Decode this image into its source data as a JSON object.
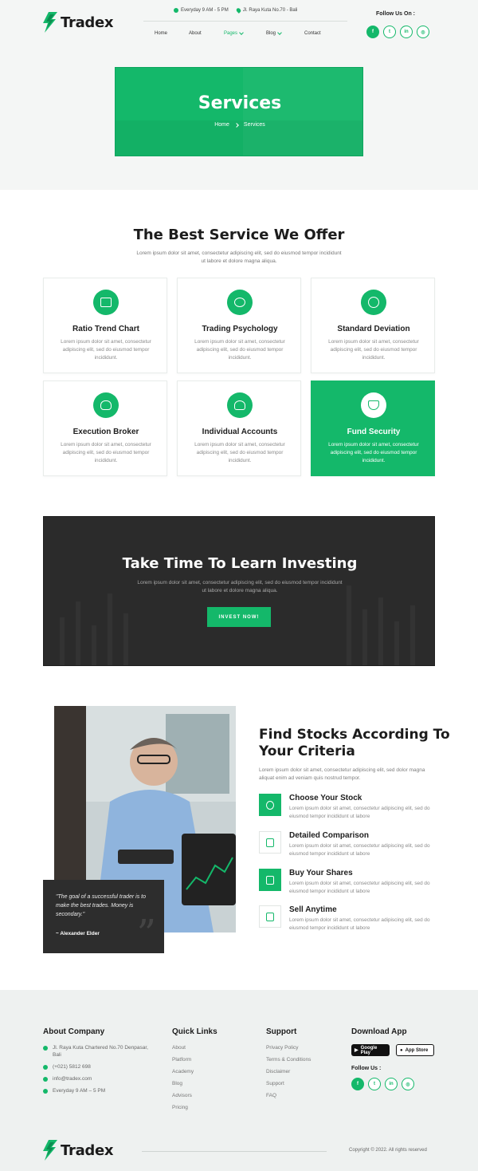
{
  "brand": {
    "name": "Tradex"
  },
  "topbar": {
    "hours": "Everyday 9 AM - 5 PM",
    "address": "Jl. Raya Kuta No.70 - Bali"
  },
  "nav": {
    "items": [
      "Home",
      "About",
      "Pages",
      "Blog",
      "Contact"
    ],
    "active": "Pages"
  },
  "follow": {
    "label": "Follow Us On :",
    "icons": [
      "facebook-icon",
      "twitter-icon",
      "linkedin-icon",
      "instagram-icon"
    ],
    "glyphs": [
      "f",
      "t",
      "in",
      "◎"
    ]
  },
  "banner": {
    "title": "Services",
    "crumb_home": "Home",
    "crumb_current": "Services"
  },
  "services": {
    "title": "The Best Service We Offer",
    "subtitle": "Lorem ipsum dolor sit amet, consectetur adipiscing elit, sed do eiusmod tempor incididunt ut labore et dolore magna aliqua.",
    "cards": [
      {
        "title": "Ratio Trend Chart",
        "text": "Lorem ipsum dolor sit amet, consectetur adipiscing elit, sed do eiusmod tempor incididunt.",
        "icon": "chart-icon"
      },
      {
        "title": "Trading Psychology",
        "text": "Lorem ipsum dolor sit amet, consectetur adipiscing elit, sed do eiusmod tempor incididunt.",
        "icon": "brain-gear-icon"
      },
      {
        "title": "Standard Deviation",
        "text": "Lorem ipsum dolor sit amet, consectetur adipiscing elit, sed do eiusmod tempor incididunt.",
        "icon": "pie-icon"
      },
      {
        "title": "Execution Broker",
        "text": "Lorem ipsum dolor sit amet, consectetur adipiscing elit, sed do eiusmod tempor incididunt.",
        "icon": "money-bag-icon"
      },
      {
        "title": "Individual Accounts",
        "text": "Lorem ipsum dolor sit amet, consectetur adipiscing elit, sed do eiusmod tempor incididunt.",
        "icon": "user-icon"
      },
      {
        "title": "Fund Security",
        "text": "Lorem ipsum dolor sit amet, consectetur adipiscing elit, sed do eiusmod tempor incididunt.",
        "icon": "shield-icon"
      }
    ]
  },
  "cta": {
    "title": "Take Time To Learn Investing",
    "subtitle": "Lorem ipsum dolor sit amet, consectetur adipiscing elit, sed do eiusmod tempor incididunt ut labore et dolore magna aliqua.",
    "button": "INVEST NOW!"
  },
  "quote": {
    "text": "\"The goal of a successful trader is to make the best trades. Money is secondary.\"",
    "author": "~ Alexander Elder"
  },
  "stocks": {
    "title": "Find Stocks According To Your Criteria",
    "subtitle": "Lorem ipsum dolor sit amet, consectetur adipiscing elit, sed dolor magna aliquat enim ad veniam quis nostrud tempor.",
    "features": [
      {
        "title": "Choose Your Stock",
        "text": "Lorem ipsum dolor sit amet, consectetur adipiscing elit, sed do eiusmod tempor incididunt ut labore"
      },
      {
        "title": "Detailed Comparison",
        "text": "Lorem ipsum dolor sit amet, consectetur adipiscing elit, sed do eiusmod tempor incididunt ut labore"
      },
      {
        "title": "Buy Your Shares",
        "text": "Lorem ipsum dolor sit amet, consectetur adipiscing elit, sed do eiusmod tempor incididunt ut labore"
      },
      {
        "title": "Sell Anytime",
        "text": "Lorem ipsum dolor sit amet, consectetur adipiscing elit, sed do eiusmod tempor incididunt ut labore"
      }
    ]
  },
  "footer": {
    "about": {
      "title": "About Company",
      "address": "Jl. Raya Kuta Chartered No.70 Denpasar, Bali",
      "phone": "(+021) 5812 698",
      "email": "info@tradex.com",
      "hours": "Everyday 9 AM – 5 PM"
    },
    "quick": {
      "title": "Quick Links",
      "links": [
        "About",
        "Platform",
        "Academy",
        "Blog",
        "Advisors",
        "Pricing"
      ]
    },
    "support": {
      "title": "Support",
      "links": [
        "Privacy Policy",
        "Terms & Conditions",
        "Disclaimer",
        "Support",
        "FAQ"
      ]
    },
    "app": {
      "title": "Download App",
      "google": "Google Play",
      "apple": "App Store",
      "follow": "Follow Us :"
    },
    "copyright": "Copyright © 2022. All rights reserved"
  },
  "colors": {
    "accent": "#14b86a",
    "dark": "#2b2b2b"
  }
}
